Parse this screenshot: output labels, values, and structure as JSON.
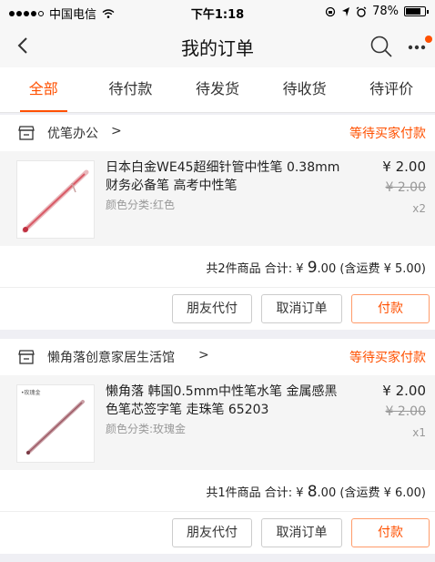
{
  "status_bar": {
    "carrier": "中国电信",
    "time": "下午1:18",
    "battery": "78%",
    "battery_level": 0.78
  },
  "nav": {
    "title": "我的订单",
    "back_icon": "chevron-left-icon",
    "search_icon": "search-icon",
    "more_icon": "more-icon"
  },
  "tabs": [
    {
      "label": "全部",
      "active": true
    },
    {
      "label": "待付款"
    },
    {
      "label": "待发货"
    },
    {
      "label": "待收货"
    },
    {
      "label": "待评价"
    }
  ],
  "colors": {
    "accent": "#ff5000",
    "background": "#efeff4",
    "item_background": "#f5f5f5",
    "muted_text": "#999999"
  },
  "orders": [
    {
      "shop_name": "优笔办公",
      "shop_arrow": ">",
      "status": "等待买家付款",
      "item": {
        "title": "日本白金WE45超细针管中性笔 0.38mm 财务必备笔 高考中性笔",
        "variant": "颜色分类:红色",
        "price": "¥ 2.00",
        "original_price": "¥ 2.00",
        "quantity": "x2",
        "thumb_label": ""
      },
      "summary": {
        "prefix": "共2件商品 合计: ¥ ",
        "total_big": "9",
        "total_small": ".00",
        "suffix": " (含运费 ¥ 5.00)"
      },
      "buttons": {
        "friend_pay": "朋友代付",
        "cancel": "取消订单",
        "pay": "付款"
      }
    },
    {
      "shop_name": "懒角落创意家居生活馆",
      "shop_arrow": ">",
      "status": "等待买家付款",
      "item": {
        "title": "懒角落 韩国0.5mm中性笔水笔 金属感黑色笔芯签字笔 走珠笔 65203",
        "variant": "颜色分类:玫瑰金",
        "price": "¥ 2.00",
        "original_price": "¥ 2.00",
        "quantity": "x1",
        "thumb_label": "•玫瑰金"
      },
      "summary": {
        "prefix": "共1件商品 合计: ¥ ",
        "total_big": "8",
        "total_small": ".00",
        "suffix": " (含运费 ¥ 6.00)"
      },
      "buttons": {
        "friend_pay": "朋友代付",
        "cancel": "取消订单",
        "pay": "付款"
      }
    }
  ]
}
